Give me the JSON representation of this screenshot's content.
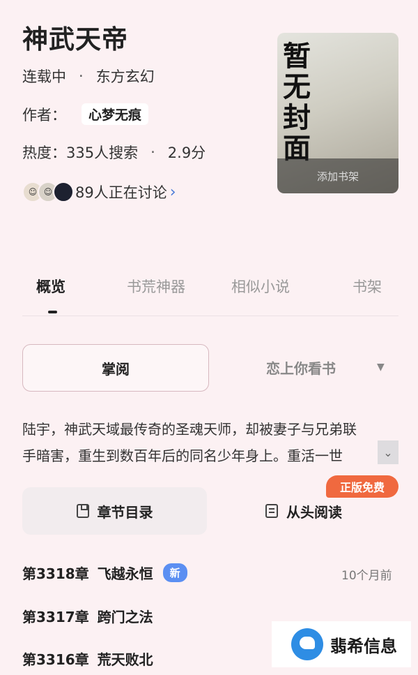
{
  "book": {
    "title": "神武天帝",
    "status": "连载中",
    "genre": "东方玄幻",
    "author_label": "作者：",
    "author_name": "心梦无痕",
    "heat": "热度：335人搜索",
    "score": "2.9分",
    "discussing": "89人正在讨论",
    "separator": "·"
  },
  "cover": {
    "placeholder_chars": [
      "暂",
      "无",
      "封",
      "面"
    ],
    "add_shelf": "添加书架"
  },
  "tabs": [
    {
      "label": "概览",
      "active": true
    },
    {
      "label": "书荒神器",
      "active": false
    },
    {
      "label": "相似小说",
      "active": false
    },
    {
      "label": "书架",
      "active": false
    }
  ],
  "source": {
    "current": "掌阅",
    "other": "恋上你看书"
  },
  "synopsis": {
    "line1": "陆宇，神武天域最传奇的圣魂天师，却被妻子与兄弟联",
    "line2": "手暗害，重生到数百年后的同名少年身上。重活一世"
  },
  "actions": {
    "free_badge": "正版免费",
    "toc": "章节目录",
    "read_from_start": "从头阅读"
  },
  "chapters": [
    {
      "number": "第3318章",
      "title": "飞越永恒",
      "badge": "新",
      "time": "10个月前"
    },
    {
      "number": "第3317章",
      "title": "跨门之法"
    },
    {
      "number": "第3316章",
      "title": "荒天败北"
    }
  ],
  "watermark": {
    "text": "翡希信息"
  },
  "colors": {
    "background": "#fcf1f3",
    "accent_blue": "#5b8ff2",
    "badge_orange": "#f0693f"
  }
}
